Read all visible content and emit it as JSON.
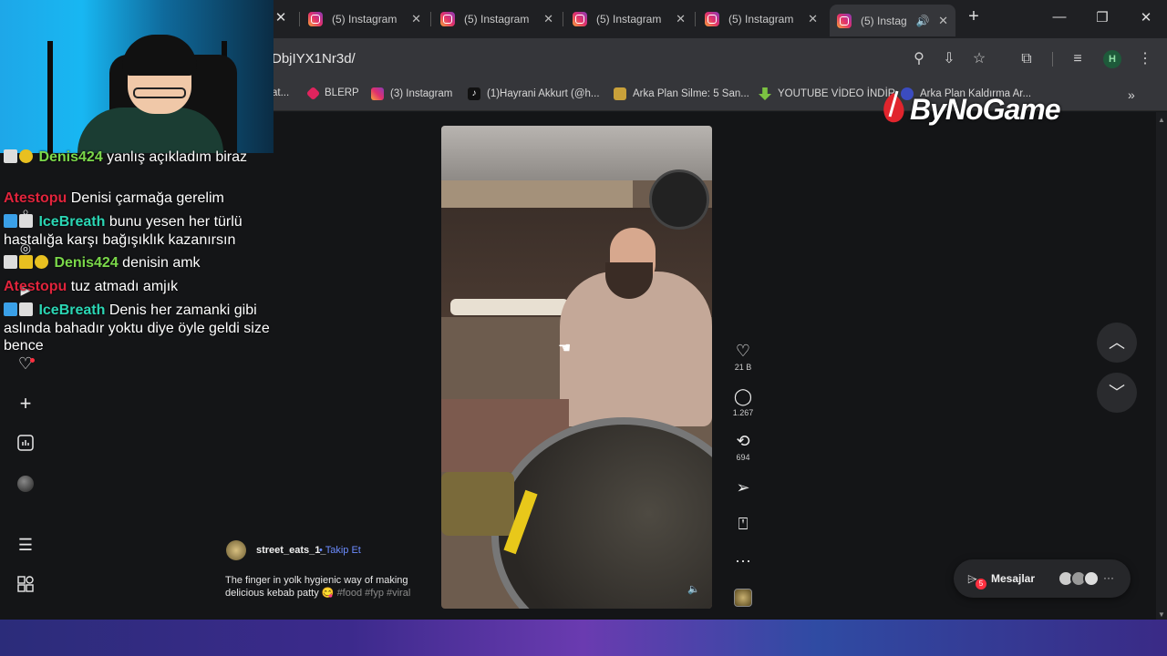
{
  "browser": {
    "tabs": [
      {
        "label": "(5) Instagram"
      },
      {
        "label": "(5) Instagram"
      },
      {
        "label": "(5) Instagram"
      },
      {
        "label": "(5) Instagram"
      },
      {
        "label": "(5) Instag"
      }
    ],
    "new_tab_icon": "plus-icon",
    "url": "DbjIYX1Nr3d/",
    "profile_initial": "H",
    "bookmarks": [
      {
        "label": "at..."
      },
      {
        "label": "BLERP"
      },
      {
        "label": "(3) Instagram"
      },
      {
        "label": "(1)Hayrani Akkurt (@h..."
      },
      {
        "label": "Arka Plan Silme: 5 San..."
      },
      {
        "label": "YOUTUBE VİDEO İNDİR"
      },
      {
        "label": "Arka Plan Kaldırma Ar..."
      }
    ]
  },
  "overlay": {
    "watermark": "ByNoGame"
  },
  "chat": [
    {
      "user": "Denis424",
      "user_color": "#7bd84a",
      "text": " yanlış açıkladım biraz"
    },
    {
      "user": "Atestopu",
      "user_color": "#e0243c",
      "text": " Denisi çarmağa gerelim"
    },
    {
      "user": "IceBreath",
      "user_color": "#2bd6b4",
      "text": " bunu yesen her türlü hastalığa karşı bağışıklık kazanırsın"
    },
    {
      "user": "Denis424",
      "user_color": "#7bd84a",
      "text": " denisin amk"
    },
    {
      "user": "Atestopu",
      "user_color": "#e0243c",
      "text": " tuz atmadı amjık"
    },
    {
      "user": "IceBreath",
      "user_color": "#2bd6b4",
      "text": " Denis her zamanki gibi aslında bahadır yoktu diye öyle geldi size bence"
    }
  ],
  "reel": {
    "username": "street_eats_1_",
    "follow_label": "• Takip Et",
    "caption": "The finger in yolk hygienic way of making delicious kebab patty 😋",
    "hashtags": "#food #fyp #viral",
    "likes": "21 B",
    "comments": "1.267",
    "reposts": "694"
  },
  "messages": {
    "label": "Mesajlar",
    "badge": "5"
  }
}
